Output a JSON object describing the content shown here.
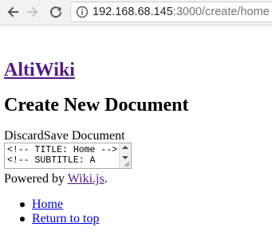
{
  "browser": {
    "url_host": "192.168.68.145",
    "url_rest": ":3000/create/home"
  },
  "site": {
    "title": "AltiWiki"
  },
  "page": {
    "heading": "Create New Document"
  },
  "actions": {
    "discard_label": "Discard",
    "save_label": "Save Document"
  },
  "editor": {
    "content": "<!-- TITLE: Home -->\n<!-- SUBTITLE: A"
  },
  "footer": {
    "powered_by": "Powered by ",
    "link": "Wiki.js",
    "suffix": ".",
    "links": [
      {
        "label": "Home"
      },
      {
        "label": "Return to top"
      }
    ]
  }
}
